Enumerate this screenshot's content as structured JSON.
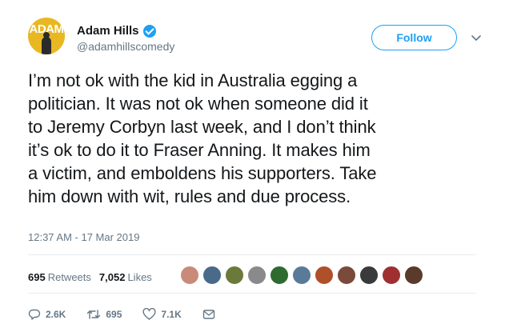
{
  "author": {
    "display_name": "Adam Hills",
    "handle": "@adamhillscomedy",
    "avatar_text": "ADAM",
    "verified": true
  },
  "follow_button": {
    "label": "Follow"
  },
  "tweet": {
    "lines": [
      "I’m not ok with the kid in Australia egging a",
      "politician. It was not ok when someone did it",
      "to Jeremy Corbyn last week, and I don’t think",
      "it’s ok to do it to Fraser Anning. It makes him",
      "a victim, and emboldens his supporters. Take",
      "him down with wit, rules and due process."
    ],
    "timestamp": "12:37 AM - 17 Mar 2019"
  },
  "stats": {
    "retweets_count": "695",
    "retweets_label": "Retweets",
    "likes_count": "7,052",
    "likes_label": "Likes"
  },
  "liker_avatars": [
    "#c98a7a",
    "#4a6a8a",
    "#6b7a3a",
    "#8a8a8a",
    "#2f6b2f",
    "#5a7a9a",
    "#b0502a",
    "#7a4a3a",
    "#3a3a3a",
    "#a03030",
    "#5a3a2a"
  ],
  "actions": {
    "reply_count": "2.6K",
    "retweet_count": "695",
    "like_count": "7.1K"
  },
  "colors": {
    "accent": "#1da1f2",
    "muted": "#657786",
    "text": "#14171a"
  }
}
